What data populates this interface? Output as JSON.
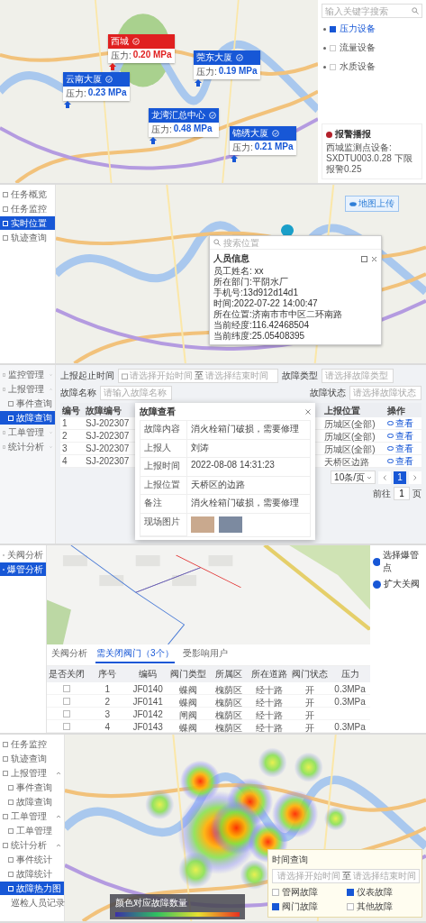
{
  "pressure_map": {
    "markers": [
      {
        "name": "西城",
        "reading_label": "压力:",
        "reading": "0.20 MPa",
        "alarm": true
      },
      {
        "name": "云南大厦",
        "reading_label": "压力:",
        "reading": "0.23 MPa",
        "alarm": false
      },
      {
        "name": "莞东大厦",
        "reading_label": "压力:",
        "reading": "0.19 MPa",
        "alarm": false
      },
      {
        "name": "龙湾汇总中心",
        "reading_label": "压力:",
        "reading": "0.48 MPa",
        "alarm": false
      },
      {
        "name": "锦绣大厦",
        "reading_label": "压力:",
        "reading": "0.21 MPa",
        "alarm": false
      }
    ],
    "search": {
      "placeholder": "输入关键字搜索"
    },
    "layers": [
      {
        "label": "压力设备",
        "selected": true
      },
      {
        "label": "流量设备",
        "selected": false
      },
      {
        "label": "水质设备",
        "selected": false
      }
    ],
    "alarm": {
      "title": "报警播报",
      "message": "西城监测点设备: SXDTU003.0.28 下限报警0.25"
    }
  },
  "location_view": {
    "sidebar": [
      {
        "label": "任务概览",
        "selected": false
      },
      {
        "label": "任务监控",
        "selected": false
      },
      {
        "label": "实时位置",
        "selected": true
      },
      {
        "label": "轨迹查询",
        "selected": false
      }
    ],
    "upload_button": "地图上传",
    "search": {
      "placeholder": "搜索位置"
    },
    "popup": {
      "title": "人员信息",
      "lines": [
        "员工姓名: xx",
        "所在部门:平阴水厂",
        "手机号:13d912d14d1",
        "时间:2022-07-22 14:00:47",
        "所在位置:济南市市中区二环南路",
        "当前经度:116.42468504",
        "当前纬度:25.05408395"
      ]
    }
  },
  "fault_query": {
    "sidebar": [
      {
        "label": "监控管理",
        "selected": false,
        "expanded": false
      },
      {
        "label": "上报管理",
        "selected": false,
        "expanded": true,
        "children": [
          {
            "label": "事件查询",
            "selected": false
          },
          {
            "label": "故障查询",
            "selected": true
          }
        ]
      },
      {
        "label": "工单管理",
        "selected": false,
        "expanded": false
      },
      {
        "label": "统计分析",
        "selected": false,
        "expanded": false
      }
    ],
    "filters": {
      "time_label": "上报起止时间",
      "start_placeholder": "请选择开始时间",
      "separator": "至",
      "end_placeholder": "请选择结束时间",
      "type_label": "故障类型",
      "type_placeholder": "请选择故障类型",
      "status_label": "故障状态",
      "status_placeholder": "请选择故障状态",
      "name_label": "故障名称",
      "name_placeholder": "请输入故障名称"
    },
    "table": {
      "columns": [
        "编号",
        "故障编号",
        "上报位置",
        "操作"
      ],
      "rows": [
        {
          "number": "1",
          "code": "SJ-202307",
          "location": "历城区(全部)",
          "action": "查看"
        },
        {
          "number": "2",
          "code": "SJ-202307",
          "location": "历城区(全部)",
          "action": "查看"
        },
        {
          "number": "3",
          "code": "SJ-202307",
          "location": "历城区(全部)",
          "action": "查看"
        },
        {
          "number": "4",
          "code": "SJ-202307",
          "location": "天桥区边路",
          "action": "查看"
        }
      ]
    },
    "pagination": {
      "page_size": "10条/页",
      "pages": [
        {
          "label": "1",
          "selected": true
        }
      ],
      "goto_label": "前往",
      "goto_value": "1",
      "goto_suffix": "页"
    },
    "modal": {
      "title": "故障查看",
      "fields": [
        {
          "label": "故障内容",
          "value": "消火栓箱门破损，需要修理"
        },
        {
          "label": "上报人",
          "value": "刘涛"
        },
        {
          "label": "上报时间",
          "value": "2022-08-08 14:31:23"
        },
        {
          "label": "上报位置",
          "value": "天桥区的边路"
        },
        {
          "label": "备注",
          "value": "消火栓箱门破损，需要修理"
        }
      ],
      "photos_label": "现场图片"
    }
  },
  "valve_analysis": {
    "sidebar": [
      {
        "label": "关阀分析",
        "selected": false
      },
      {
        "label": "爆管分析",
        "selected": true
      }
    ],
    "actions": [
      "选择爆管点",
      "扩大关阀"
    ],
    "tabs": [
      {
        "label": "关阀分析",
        "selected": false
      },
      {
        "label": "需关闭阀门（3个）",
        "selected": true
      },
      {
        "label": "受影响用户",
        "selected": false
      }
    ],
    "table": {
      "columns": [
        "是否关闭",
        "序号",
        "编码",
        "阀门类型",
        "所属区",
        "所在道路",
        "阀门状态",
        "压力"
      ],
      "rows": [
        {
          "checked": false,
          "number": "1",
          "code": "JF0140",
          "valve_type": "蝶阀",
          "district": "槐荫区",
          "road": "经十路",
          "status": "开",
          "pressure": "0.3MPa"
        },
        {
          "checked": false,
          "number": "2",
          "code": "JF0141",
          "valve_type": "蝶阀",
          "district": "槐荫区",
          "road": "经十路",
          "status": "开",
          "pressure": "0.3MPa"
        },
        {
          "checked": false,
          "number": "3",
          "code": "JF0142",
          "valve_type": "闸阀",
          "district": "槐荫区",
          "road": "经十路",
          "status": "开"
        },
        {
          "checked": false,
          "number": "4",
          "code": "JF0143",
          "valve_type": "蝶阀",
          "district": "槐荫区",
          "road": "经十路",
          "status": "开",
          "pressure": "0.3MPa"
        }
      ]
    }
  },
  "heatmap": {
    "sidebar": [
      {
        "label": "任务监控",
        "selected": false
      },
      {
        "label": "轨迹查询",
        "selected": false
      },
      {
        "label": "上报管理",
        "selected": false,
        "expanded": true,
        "children": [
          {
            "label": "事件查询",
            "selected": false
          },
          {
            "label": "故障查询",
            "selected": false
          }
        ]
      },
      {
        "label": "工单管理",
        "selected": false,
        "expanded": true,
        "children": [
          {
            "label": "工单管理",
            "selected": false
          }
        ]
      },
      {
        "label": "统计分析",
        "selected": false,
        "expanded": true,
        "children": [
          {
            "label": "事件统计",
            "selected": false
          },
          {
            "label": "故障统计",
            "selected": false
          },
          {
            "label": "故障热力图",
            "selected": true
          },
          {
            "label": "巡检人员记录",
            "selected": false
          }
        ]
      }
    ],
    "legend": {
      "title": "颜色对应故障数量"
    },
    "filter": {
      "label": "时间查询",
      "start_placeholder": "请选择开始时间",
      "separator": "至",
      "end_placeholder": "请选择结束时间",
      "types": [
        {
          "label": "管网故障",
          "checked": false
        },
        {
          "label": "仪表故障",
          "checked": true
        },
        {
          "label": "阀门故障",
          "checked": true
        },
        {
          "label": "其他故障",
          "checked": false
        }
      ]
    }
  }
}
